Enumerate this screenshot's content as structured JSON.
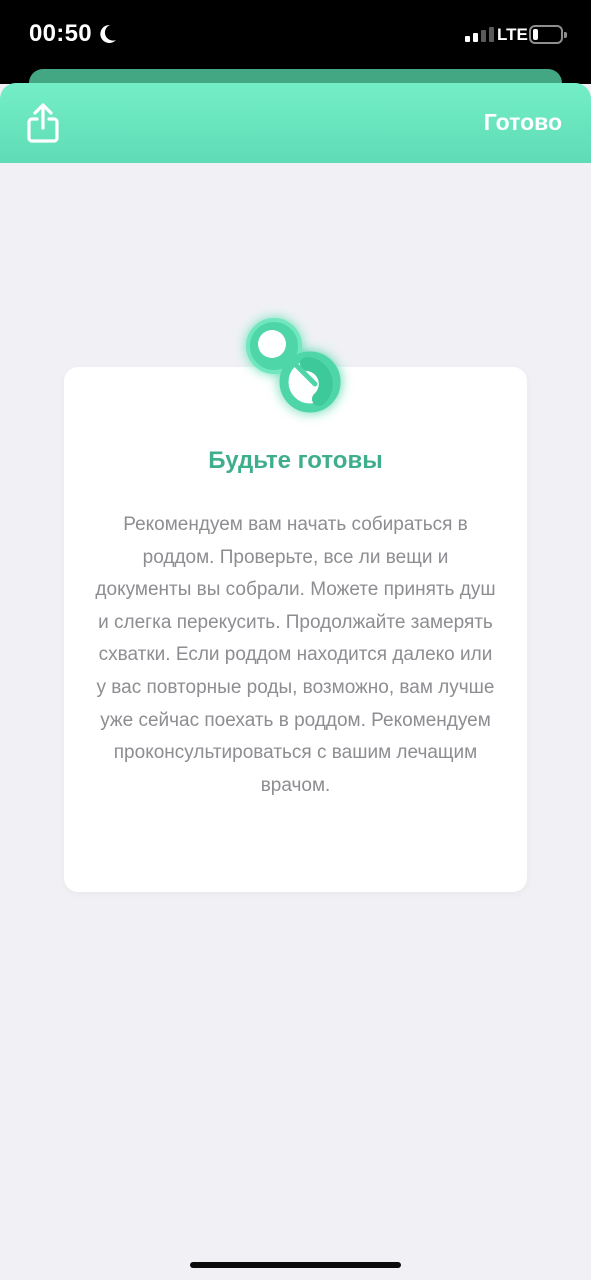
{
  "status_bar": {
    "time": "00:50",
    "network": "LTE",
    "battery_level": 0.2,
    "icons": [
      "moon-icon",
      "signal-icon",
      "battery-icon"
    ]
  },
  "header": {
    "share_icon": "share-icon",
    "done_label": "Готово"
  },
  "card": {
    "icon": "pacifier-icon",
    "title": "Будьте готовы",
    "text": "Рекомендуем вам начать собираться в роддом. Проверьте, все ли вещи и документы вы собрали. Можете принять душ и слегка перекусить. Продолжайте замерять схватки. Если роддом находится далеко или у вас повторные роды, возможно, вам лучше уже сейчас поехать в роддом. Рекомендуем проконсультироваться с вашим лечащим врачом."
  },
  "colors": {
    "accent": "#3fae8c",
    "header_top": "#74eec6",
    "header_bottom": "#5fdcb6",
    "background": "#f1f1f5",
    "body_text": "#8d8d92"
  }
}
